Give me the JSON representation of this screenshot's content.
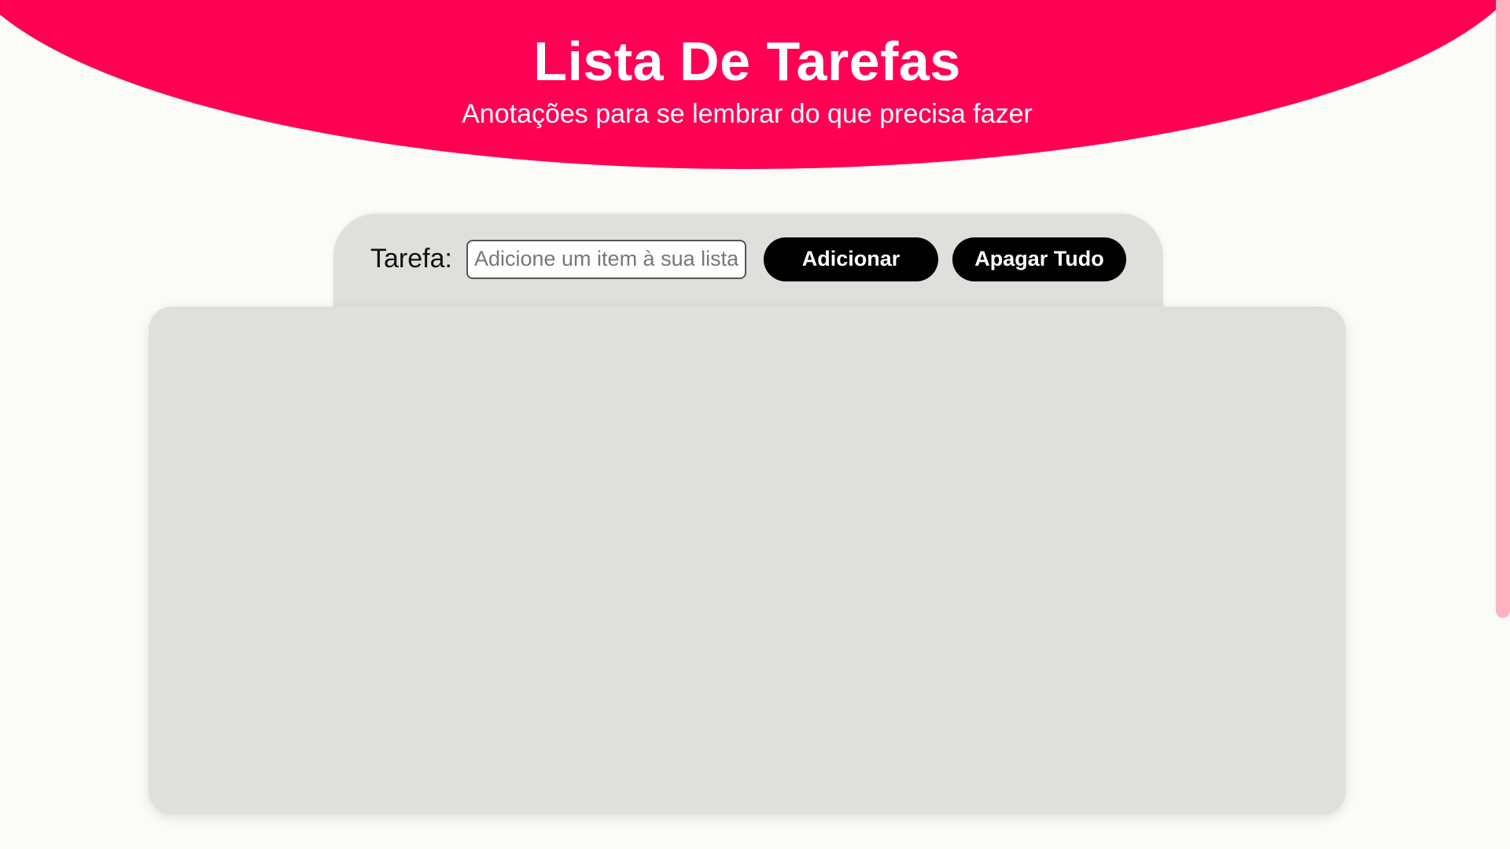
{
  "header": {
    "title": "Lista De Tarefas",
    "subtitle": "Anotações para se lembrar do que precisa fazer"
  },
  "form": {
    "label": "Tarefa:",
    "input_placeholder": "Adicione um item à sua lista",
    "input_value": "",
    "add_button": "Adicionar",
    "clear_button": "Apagar Tudo"
  },
  "list": {
    "items": []
  },
  "colors": {
    "accent": "#ff0054",
    "panel": "#dfdfdb",
    "button": "#000000",
    "background": "#fbfbf8",
    "scrollbar": "#ffb3c2"
  }
}
